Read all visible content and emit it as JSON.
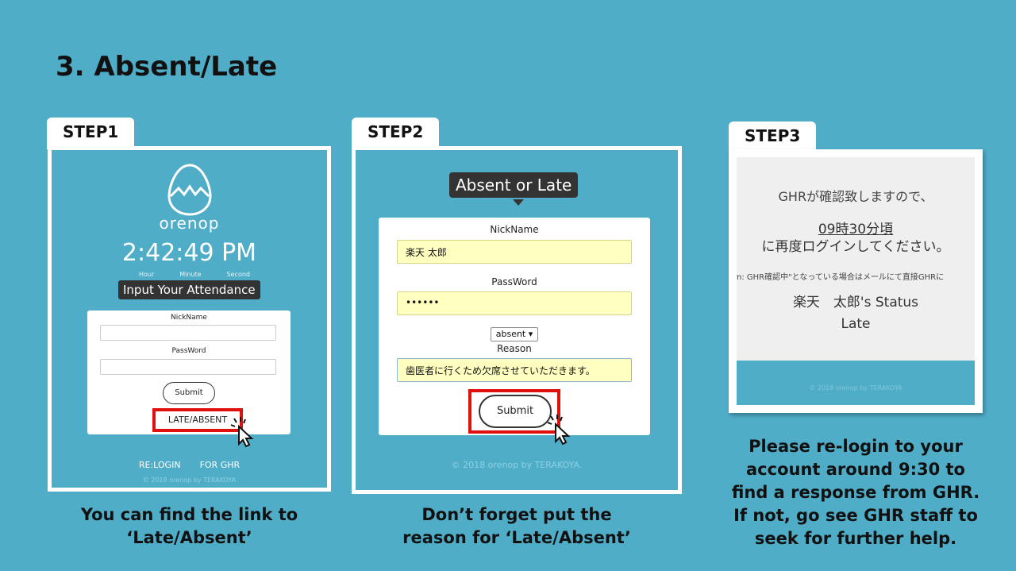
{
  "title": "3. Absent/Late",
  "step1": {
    "tab": "STEP1",
    "logo_text": "orenop",
    "clock": "2:42:49 PM",
    "clock_units": [
      "Hour",
      "Minute",
      "Second"
    ],
    "attendance_label": "Input Your Attendance",
    "nickname_label": "NickName",
    "password_label": "PassWord",
    "submit_label": "Submit",
    "late_link": "LATE/ABSENT",
    "relogin_link": "RE:LOGIN",
    "for_ghr_link": "FOR GHR",
    "copyright": "© 2018 orenop by TERAKOYA",
    "caption_line1": "You can find the link to",
    "caption_line2": "‘Late/Absent’"
  },
  "step2": {
    "tab": "STEP2",
    "heading": "Absent or Late",
    "nickname_label": "NickName",
    "nickname_value": "楽天 太郎",
    "password_label": "PassWord",
    "password_value": "••••••",
    "select_value": "absent ▾",
    "reason_label": "Reason",
    "reason_value": "歯医者に行くため欠席させていただきます。",
    "submit_label": "Submit",
    "copyright": "© 2018 orenop by TERAKOYA.",
    "caption_line1": "Don’t forget put the",
    "caption_line2": "reason for ‘Late/Absent’"
  },
  "step3": {
    "tab": "STEP3",
    "line1": "GHRが確認致しますので、",
    "line2": "09時30分頃",
    "line3": "に再度ログインしてください。",
    "line4": "nfirm: GHR確認中\"となっている場合はメールにて直接GHRに",
    "status": "楽天　太郎's Status",
    "status_value": "Late",
    "copyright": "© 2018 orenop by TERAKOYA",
    "caption_lines": [
      "Please re-login to your",
      "account around 9:30 to",
      "find a response from GHR.",
      "If not, go see GHR staff to",
      "seek for further help."
    ]
  },
  "colors": {
    "background": "#4fadc8",
    "highlight": "#e0100f",
    "input_fill": "#ffffbf"
  },
  "icons": [
    "egg-logo-icon",
    "pointer-cursor-icon"
  ]
}
